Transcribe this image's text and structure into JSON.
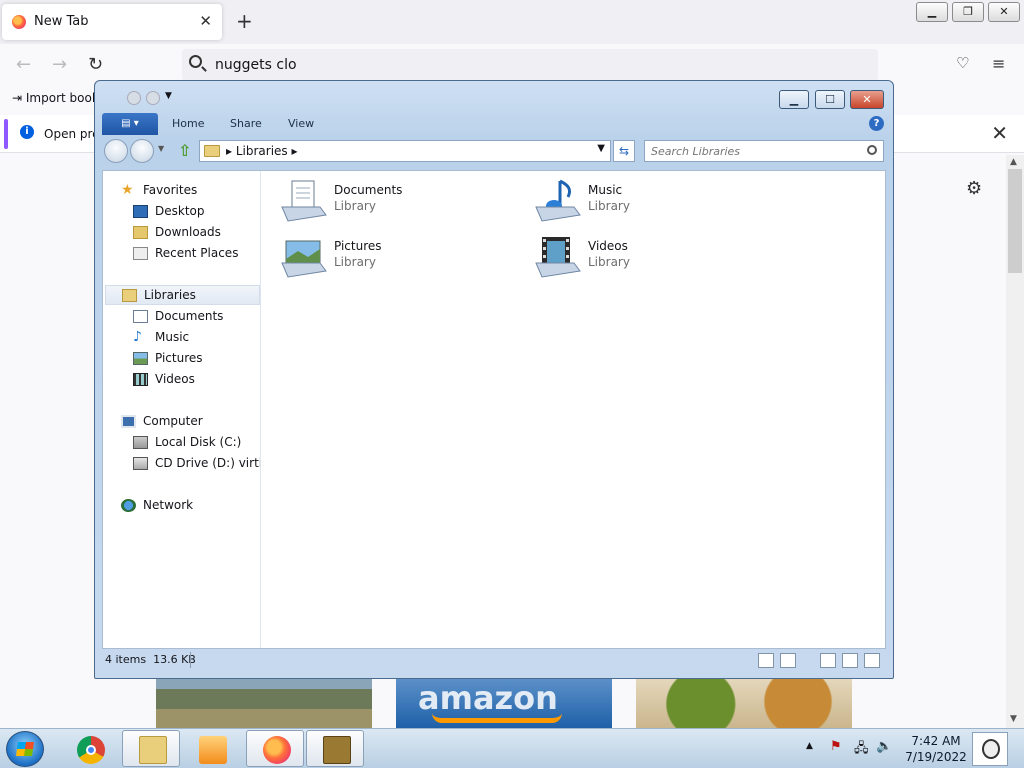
{
  "browser": {
    "tab_title": "New Tab",
    "tab_close": "✕",
    "new_tab": "+",
    "url_text": "nuggets clo",
    "bookmark_item": "Import bool",
    "notice_text": "Open pre",
    "notice_close": "✕",
    "tiles_text_amazon": "amazon"
  },
  "explorer": {
    "ribbon_tabs": [
      "Home",
      "Share",
      "View"
    ],
    "help": "?",
    "breadcrumb": "Libraries",
    "search_placeholder": "Search Libraries",
    "nav": {
      "favorites": "Favorites",
      "desktop": "Desktop",
      "downloads": "Downloads",
      "recent": "Recent Places",
      "libraries": "Libraries",
      "documents": "Documents",
      "music": "Music",
      "pictures": "Pictures",
      "videos": "Videos",
      "computer": "Computer",
      "local_disk": "Local Disk (C:)",
      "cd_drive": "CD Drive (D:) virtio-w",
      "network": "Network"
    },
    "libraries": [
      {
        "name": "Documents",
        "type": "Library"
      },
      {
        "name": "Music",
        "type": "Library"
      },
      {
        "name": "Pictures",
        "type": "Library"
      },
      {
        "name": "Videos",
        "type": "Library"
      }
    ],
    "status_items": "4 items",
    "status_size": "13.6 KB"
  },
  "taskbar": {
    "time": "7:42 AM",
    "date": "7/19/2022"
  },
  "colors": {
    "accent": "#1f56a5",
    "firefox_purple": "#9059ff"
  }
}
